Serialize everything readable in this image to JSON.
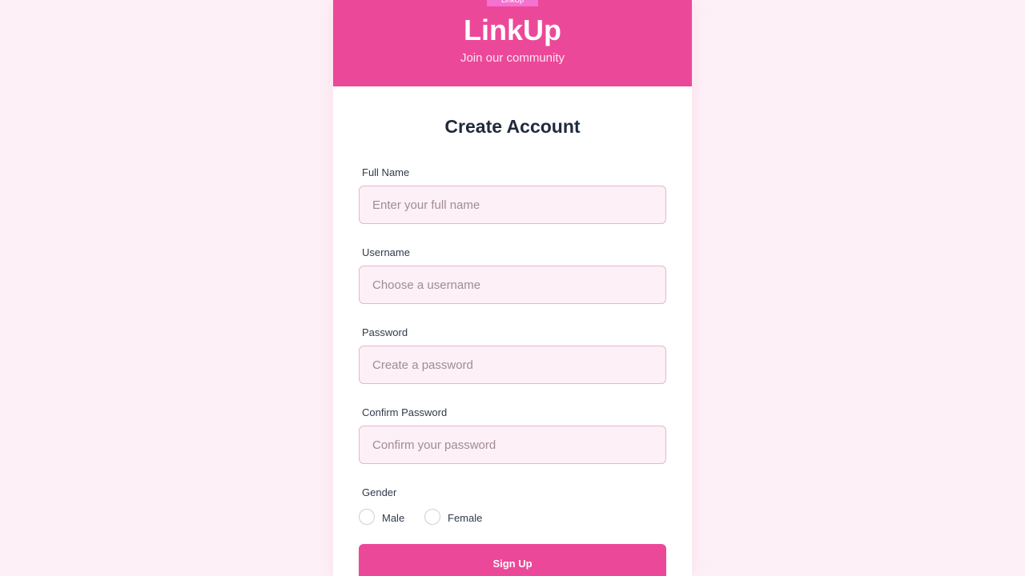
{
  "header": {
    "badge": "LinkUp",
    "brand": "LinkUp",
    "tagline": "Join our community"
  },
  "form": {
    "title": "Create Account",
    "fields": [
      {
        "label": "Full Name",
        "placeholder": "Enter your full name",
        "value": ""
      },
      {
        "label": "Username",
        "placeholder": "Choose a username",
        "value": ""
      },
      {
        "label": "Password",
        "placeholder": "Create a password",
        "value": ""
      },
      {
        "label": "Confirm Password",
        "placeholder": "Confirm your password",
        "value": ""
      }
    ],
    "gender": {
      "label": "Gender",
      "options": [
        "Male",
        "Female"
      ],
      "selected": null
    },
    "submit_label": "Sign Up"
  },
  "colors": {
    "accent": "#ec4899",
    "page_background": "#fdf0f6",
    "input_background": "#fdf0f6",
    "title_text": "#1f2a3c"
  }
}
